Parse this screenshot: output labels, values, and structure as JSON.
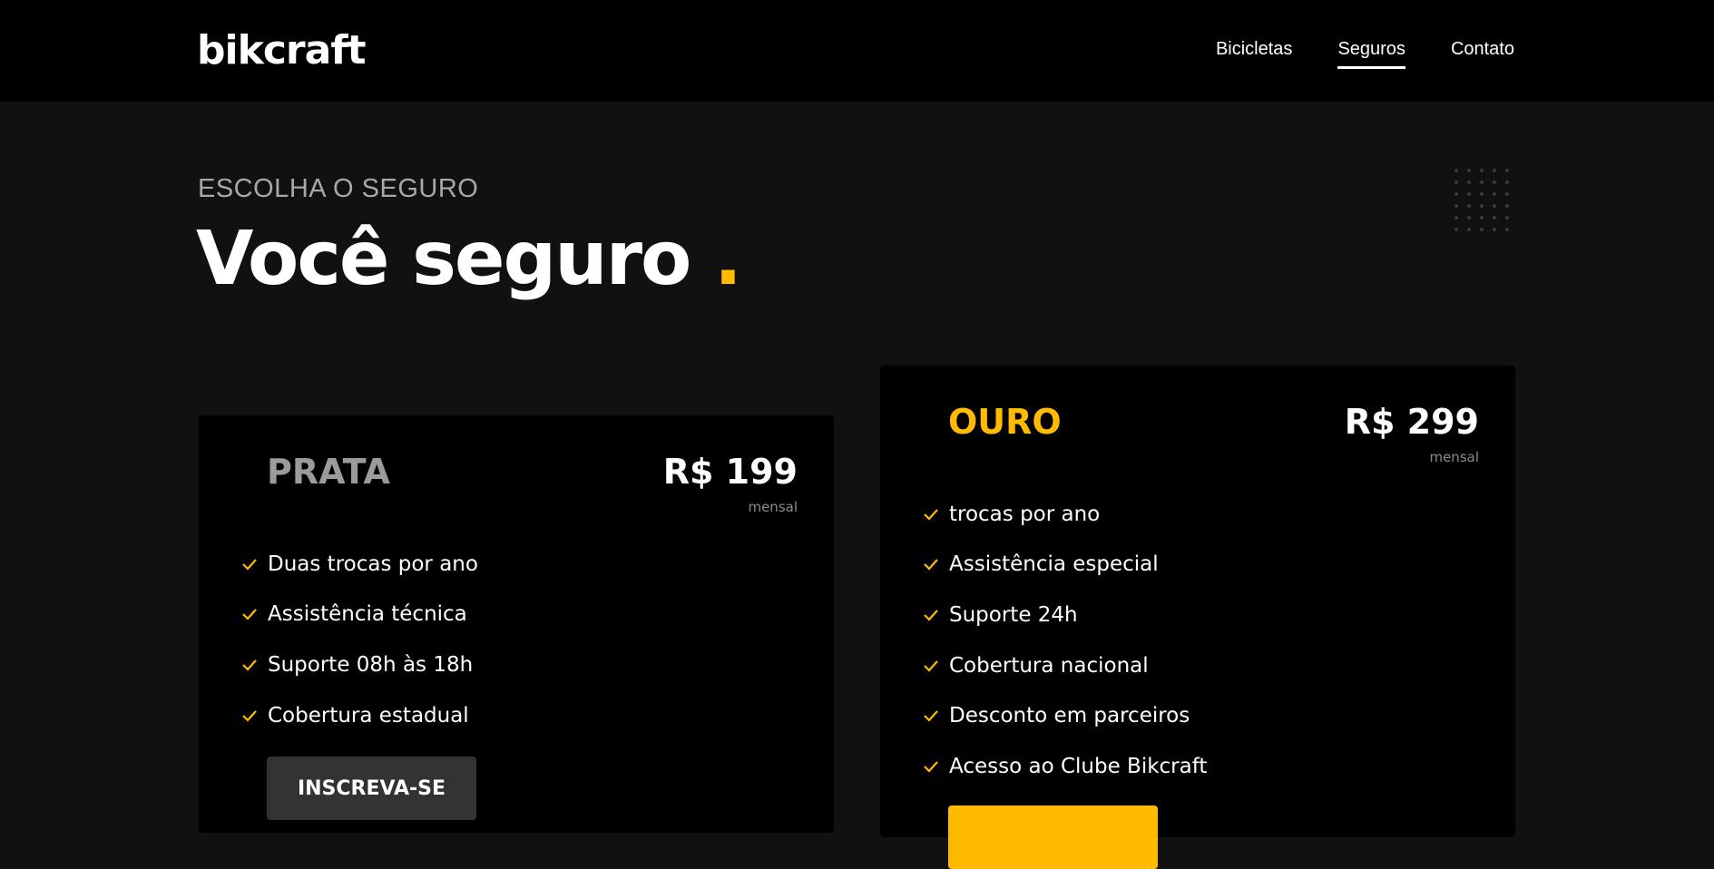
{
  "header": {
    "logo": "bikcraft",
    "nav": [
      {
        "label": "Bicicletas",
        "active": false
      },
      {
        "label": "Seguros",
        "active": true
      },
      {
        "label": "Contato",
        "active": false
      }
    ]
  },
  "hero": {
    "eyebrow": "ESCOLHA O SEGURO",
    "title": "Você seguro",
    "title_dot": "."
  },
  "plans": [
    {
      "name": "PRATA",
      "price": "R$ 199",
      "period": "mensal",
      "features": [
        "Duas trocas por ano",
        "Assistência técnica",
        "Suporte 08h às 18h",
        "Cobertura estadual"
      ],
      "button_label": "INSCREVA-SE"
    },
    {
      "name": "OURO",
      "price": "R$ 299",
      "period": "mensal",
      "features": [
        "trocas por ano",
        "Assistência especial",
        "Suporte 24h",
        "Cobertura nacional",
        "Desconto em parceiros",
        "Acesso ao Clube Bikcraft"
      ],
      "button_label": ""
    }
  ],
  "colors": {
    "accent": "#ffbb00",
    "background": "#111111",
    "header_bg": "#000000",
    "card_bg": "#000000"
  },
  "icons": {
    "feature_bullet": "check-icon",
    "decoration": "dot-grid"
  }
}
